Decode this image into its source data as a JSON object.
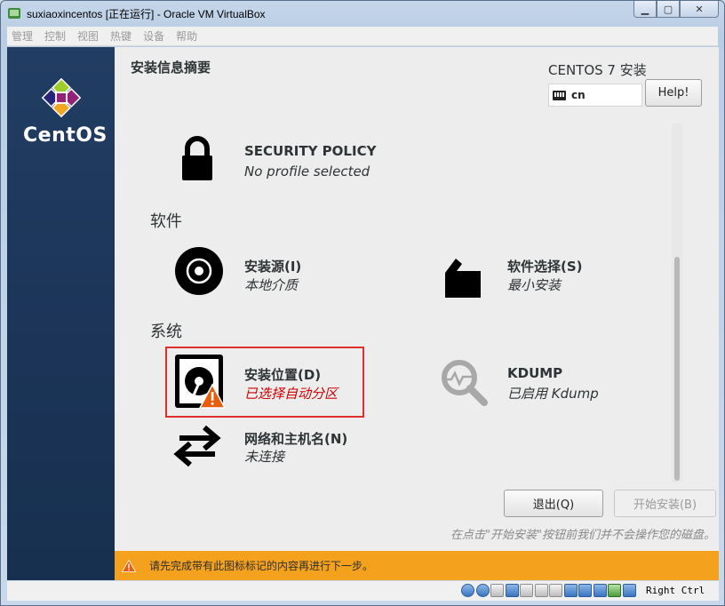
{
  "window": {
    "title": "suxiaoxincentos [正在运行] - Oracle VM VirtualBox",
    "menu": [
      "管理",
      "控制",
      "视图",
      "热键",
      "设备",
      "帮助"
    ]
  },
  "sidebar": {
    "logo_text": "CentOS"
  },
  "header": {
    "title": "安装信息摘要",
    "product": "CENTOS 7 安装",
    "keyboard_layout": "cn",
    "help_label": "Help!"
  },
  "spokes": {
    "security": {
      "title": "SECURITY POLICY",
      "status": "No profile selected"
    },
    "software_category": "软件",
    "source": {
      "title": "安装源(I)",
      "status": "本地介质"
    },
    "selection": {
      "title": "软件选择(S)",
      "status": "最小安装"
    },
    "system_category": "系统",
    "destination": {
      "title": "安装位置(D)",
      "status": "已选择自动分区"
    },
    "kdump": {
      "title": "KDUMP",
      "status": "已启用 Kdump"
    },
    "network": {
      "title": "网络和主机名(N)",
      "status": "未连接"
    }
  },
  "actions": {
    "quit_label": "退出(Q)",
    "begin_label": "开始安装(B)",
    "note": "在点击\"开始安装\"按钮前我们并不会操作您的磁盘。"
  },
  "warning_bar": {
    "text": "请先完成带有此图标标记的内容再进行下一步。"
  },
  "statusbar": {
    "host_key": "Right Ctrl"
  },
  "colors": {
    "warning": "#f4a21d",
    "error_text": "#cc0000",
    "sidebar": "#1c3559",
    "highlight": "#e0302b"
  }
}
